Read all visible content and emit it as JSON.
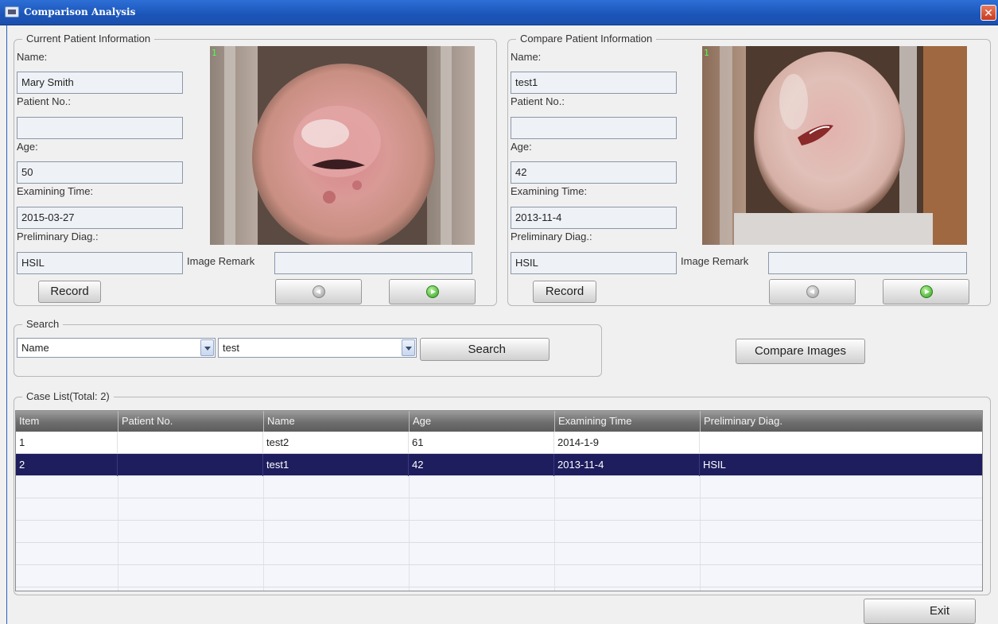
{
  "window": {
    "title": "Comparison Analysis",
    "close_glyph": "✕"
  },
  "current": {
    "legend": "Current Patient Information",
    "name_label": "Name:",
    "name_value": "Mary Smith",
    "patient_no_label": "Patient No.:",
    "patient_no_value": "",
    "age_label": "Age:",
    "age_value": "50",
    "exam_time_label": "Examining Time:",
    "exam_time_value": "2015-03-27",
    "diag_label": "Preliminary Diag.:",
    "diag_value": "HSIL",
    "image_remark_label": "Image Remark",
    "image_remark_value": "",
    "record_label": "Record",
    "image_index": "1"
  },
  "compare": {
    "legend": "Compare Patient Information",
    "name_label": "Name:",
    "name_value": "test1",
    "patient_no_label": "Patient No.:",
    "patient_no_value": "",
    "age_label": "Age:",
    "age_value": "42",
    "exam_time_label": "Examining Time:",
    "exam_time_value": "2013-11-4",
    "diag_label": "Preliminary Diag.:",
    "diag_value": "HSIL",
    "image_remark_label": "Image Remark",
    "image_remark_value": "",
    "record_label": "Record",
    "image_index": "1"
  },
  "search": {
    "legend": "Search",
    "field_value": "Name",
    "query_value": "test",
    "button_label": "Search"
  },
  "compare_images_label": "Compare Images",
  "case_list": {
    "legend": "Case List(Total: 2)",
    "columns": [
      "Item",
      "Patient No.",
      "Name",
      "Age",
      "Examining Time",
      "Preliminary Diag."
    ],
    "rows": [
      [
        "1",
        "",
        "test2",
        "61",
        "2014-1-9",
        ""
      ],
      [
        "2",
        "",
        "test1",
        "42",
        "2013-11-4",
        "HSIL"
      ]
    ],
    "selected_row": 1
  },
  "exit_label": "Exit",
  "colors": {
    "titlebar": "#1b55b8",
    "selected_row": "#1e1d5e",
    "table_header": "#6e6e6e"
  },
  "icons": [
    "app-icon",
    "close-icon",
    "prev-arrow-icon",
    "next-arrow-icon",
    "dropdown-arrow-icon"
  ]
}
